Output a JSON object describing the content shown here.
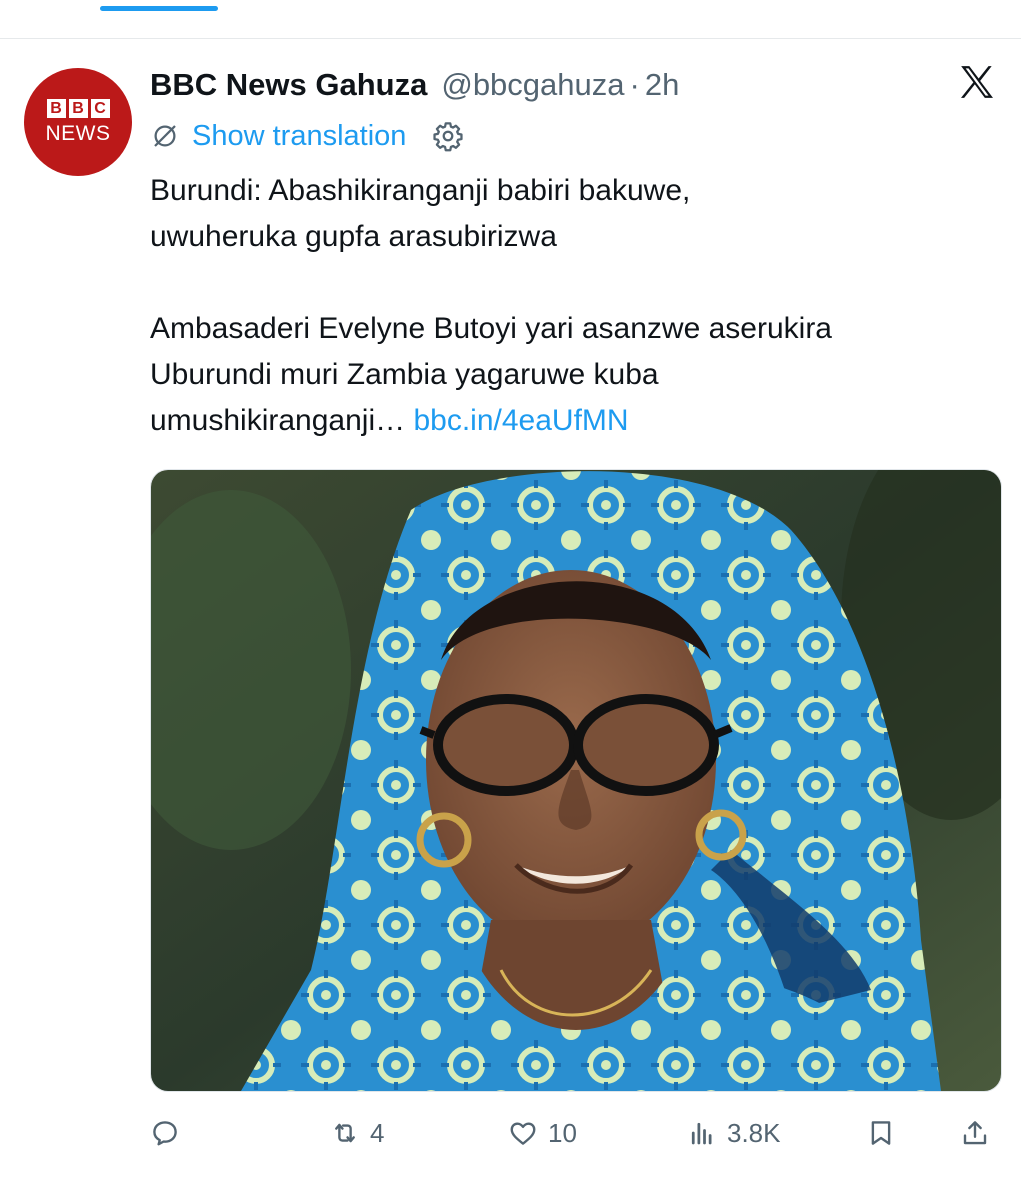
{
  "tweet": {
    "author": {
      "name": "BBC News Gahuza",
      "handle": "@bbcgahuza",
      "separator": "·",
      "time": "2h",
      "avatar": {
        "logo_letters": [
          "B",
          "B",
          "C"
        ],
        "logo_word": "NEWS",
        "color": "#bb1919"
      }
    },
    "translation_label": "Show translation",
    "text_line1": "Burundi: Abashikiranganji babiri bakuwe,",
    "text_line2": "uwuheruka gupfa arasubirizwa",
    "text_line3": "Ambasaderi Evelyne Butoyi yari asanzwe aserukira",
    "text_line4": "Uburundi muri Zambia yagaruwe kuba",
    "text_line5": "umushikiranganji…",
    "link_text": "bbc.in/4eaUfMN",
    "stats": {
      "replies": "",
      "retweets": "4",
      "likes": "10",
      "views": "3.8K"
    }
  },
  "icons": {
    "close": "x-logo-icon",
    "translate": "translate-icon",
    "settings": "gear-icon",
    "reply": "reply-icon",
    "retweet": "retweet-icon",
    "like": "heart-icon",
    "views": "views-icon",
    "bookmark": "bookmark-icon",
    "share": "share-icon"
  },
  "colors": {
    "accent": "#1d9bf0",
    "text": "#0f1419",
    "muted": "#536471",
    "bbc_red": "#bb1919"
  }
}
